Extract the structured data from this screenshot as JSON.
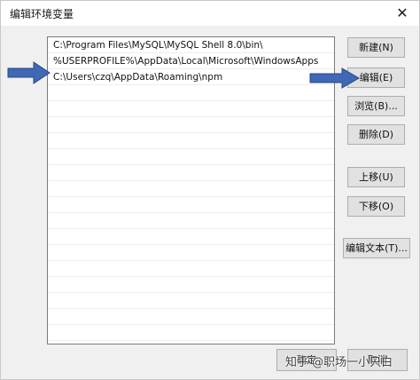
{
  "window": {
    "title": "编辑环境变量",
    "close_glyph": "✕"
  },
  "list": {
    "rows": [
      "C:\\Program Files\\MySQL\\MySQL Shell 8.0\\bin\\",
      "%USERPROFILE%\\AppData\\Local\\Microsoft\\WindowsApps",
      "C:\\Users\\czq\\AppData\\Roaming\\npm"
    ]
  },
  "buttons": {
    "new": "新建(N)",
    "edit": "编辑(E)",
    "browse": "浏览(B)...",
    "delete": "删除(D)",
    "move_up": "上移(U)",
    "move_down": "下移(O)",
    "edit_text": "编辑文本(T)...",
    "ok": "确定",
    "cancel": "取消"
  },
  "watermark": "知乎 @职场一小只白",
  "colors": {
    "annotation_arrow": "#3f68b6",
    "arrow_outline": "#27477f"
  },
  "icons": [
    "close-icon",
    "annotation-arrow-icon"
  ]
}
